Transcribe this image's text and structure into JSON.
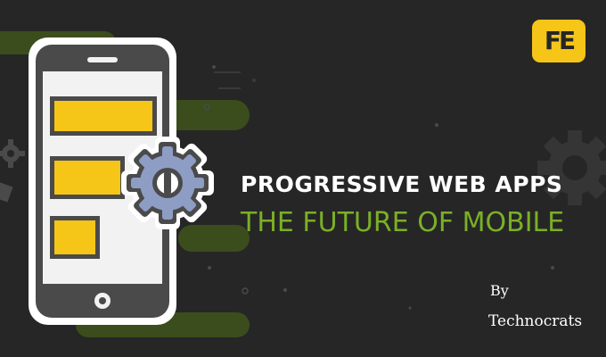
{
  "logo": {
    "text": "FE",
    "color": "#f5c518"
  },
  "headline": "PROGRESSIVE WEB APPS",
  "subheadline": "THE FUTURE OF MOBILE",
  "byline": "By",
  "author": "Technocrats",
  "colors": {
    "background": "#262626",
    "accent_green": "#7ab026",
    "accent_yellow": "#f5c518",
    "gear_blue": "#8e9dc4"
  },
  "icons": [
    "phone-icon",
    "gear-icon",
    "logo-icon"
  ]
}
